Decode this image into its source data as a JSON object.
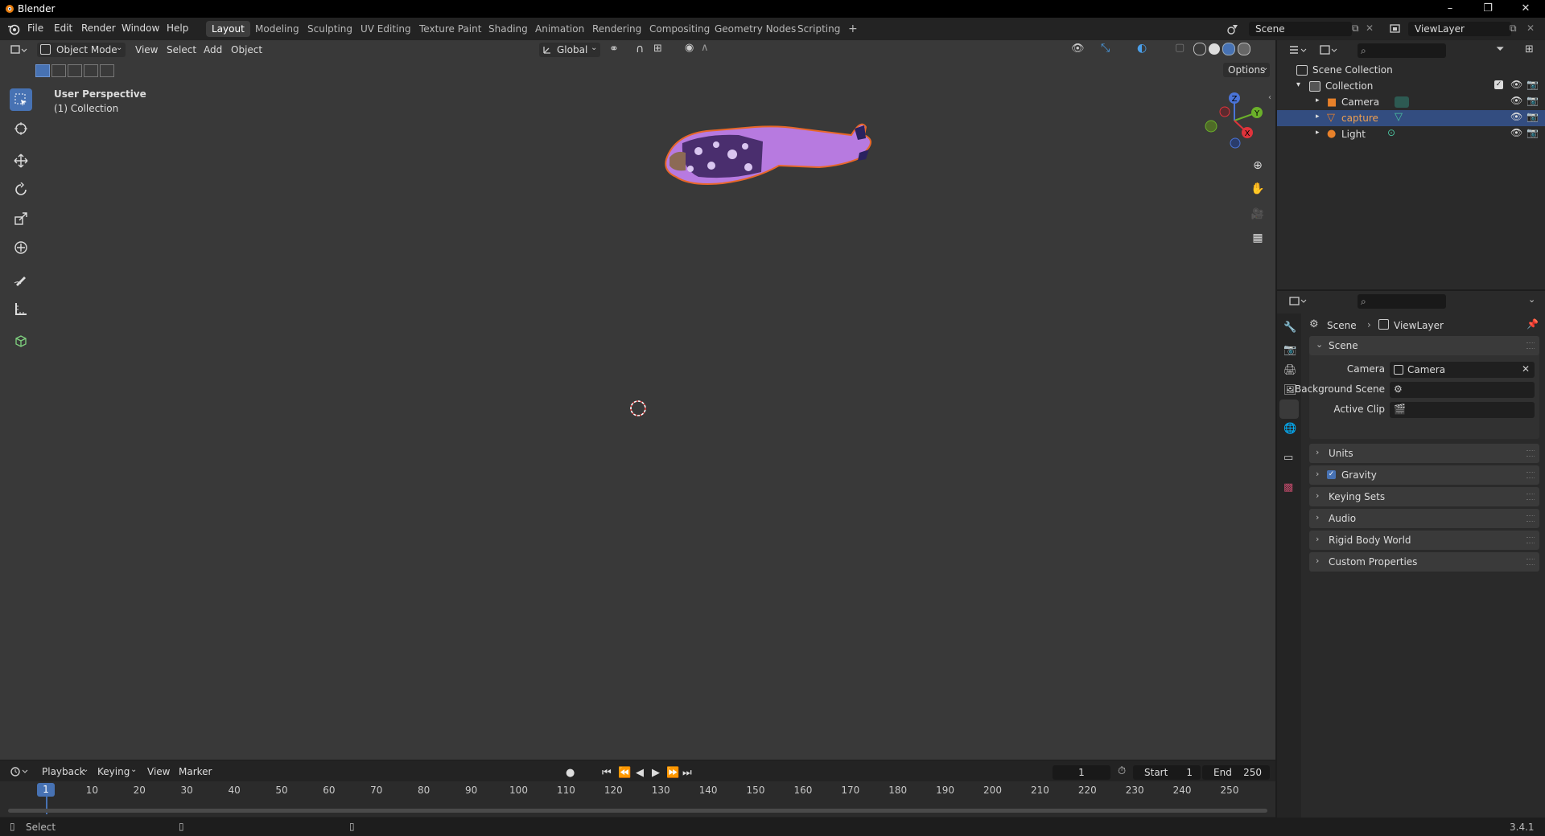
{
  "window": {
    "title": "Blender",
    "minimize": "–",
    "restore": "❐",
    "close": "✕"
  },
  "menu": {
    "file": "File",
    "edit": "Edit",
    "render": "Render",
    "window": "Window",
    "help": "Help"
  },
  "workspaces": [
    "Layout",
    "Modeling",
    "Sculpting",
    "UV Editing",
    "Texture Paint",
    "Shading",
    "Animation",
    "Rendering",
    "Compositing",
    "Geometry Nodes",
    "Scripting"
  ],
  "workspace_add": "+",
  "scene_field": "Scene",
  "viewlayer_field": "ViewLayer",
  "viewport_header": {
    "mode": "Object Mode",
    "view": "View",
    "select": "Select",
    "add": "Add",
    "object": "Object",
    "orientation": "Global",
    "options": "Options"
  },
  "viewport_overlay": {
    "perspective": "User Perspective",
    "collection": "(1) Collection"
  },
  "gizmo": {
    "x": "X",
    "y": "Y",
    "z": "Z"
  },
  "outliner": {
    "root": "Scene Collection",
    "collection": "Collection",
    "items": [
      {
        "name": "Camera"
      },
      {
        "name": "capture"
      },
      {
        "name": "Light"
      }
    ]
  },
  "properties": {
    "breadcrumb_scene": "Scene",
    "breadcrumb_viewlayer": "ViewLayer",
    "scene_panel": "Scene",
    "camera_label": "Camera",
    "camera_value": "Camera",
    "background_scene_label": "Background Scene",
    "active_clip_label": "Active Clip",
    "panels": [
      "Units",
      "Gravity",
      "Keying Sets",
      "Audio",
      "Rigid Body World",
      "Custom Properties"
    ]
  },
  "timeline": {
    "playback": "Playback",
    "keying": "Keying",
    "view": "View",
    "marker": "Marker",
    "current_frame": "1",
    "start_label": "Start",
    "start_value": "1",
    "end_label": "End",
    "end_value": "250",
    "ruler_current": "1",
    "ruler": [
      "10",
      "20",
      "30",
      "40",
      "50",
      "60",
      "70",
      "80",
      "90",
      "100",
      "110",
      "120",
      "130",
      "140",
      "150",
      "160",
      "170",
      "180",
      "190",
      "200",
      "210",
      "220",
      "230",
      "240",
      "250"
    ]
  },
  "status": {
    "select": "Select",
    "version": "3.4.1"
  },
  "colors": {
    "accent": "#4772b3",
    "selected_object": "#e8812a",
    "viewport_bg": "#393939"
  }
}
